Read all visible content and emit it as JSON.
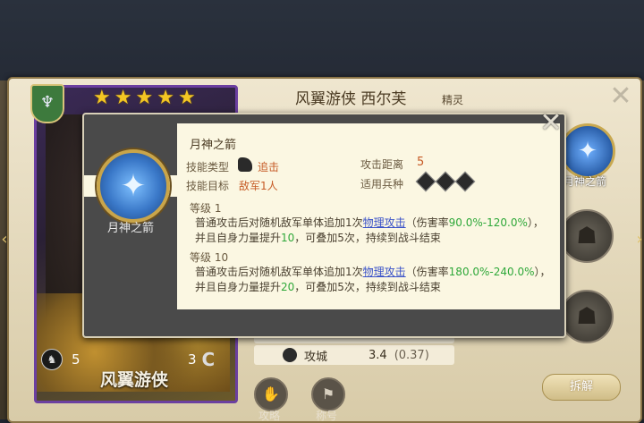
{
  "hero": {
    "name": "风翼游侠",
    "title_line": "风翼游侠 西尔芙",
    "class": "精灵",
    "stars": [
      "★",
      "★",
      "★",
      "★",
      "★"
    ],
    "badge_icon": "hand-crest-icon",
    "foot_left_value": "5",
    "foot_right_value": "3",
    "foot_right_badge": "C"
  },
  "right_skills": {
    "active_label": "月神之箭"
  },
  "stats": {
    "row": {
      "label": "攻城",
      "value": "3.4",
      "delta": "(0.37)"
    }
  },
  "bottom_buttons": {
    "guide": "攻略",
    "title": "称号"
  },
  "dismiss_label": "拆解",
  "popup": {
    "skill_name": "月神之箭",
    "medal_label": "月神之箭",
    "type_key": "技能类型",
    "type_value": "追击",
    "range_key": "攻击距离",
    "range_value": "5",
    "target_key": "技能目标",
    "target_value": "敌军1人",
    "units_key": "适用兵种",
    "levels": [
      {
        "label": "等级 1",
        "p1": "普通攻击后对随机敌军单体追加1次",
        "link": "物理攻击",
        "p2": "（伤害率",
        "pct": "90.0%-120.0%",
        "p3": "），并且自身力量提升",
        "boost": "10",
        "p4": "，可叠加5次，持续到战斗结束"
      },
      {
        "label": "等级 10",
        "p1": "普通攻击后对随机敌军单体追加1次",
        "link": "物理攻击",
        "p2": "（伤害率",
        "pct": "180.0%-240.0%",
        "p3": "），并且自身力量提升",
        "boost": "20",
        "p4": "，可叠加5次，持续到战斗结束"
      }
    ]
  }
}
